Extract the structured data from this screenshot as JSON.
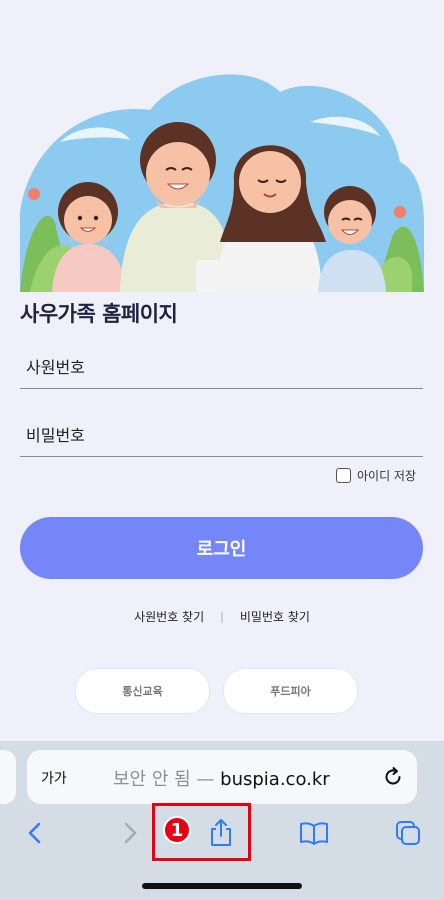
{
  "page": {
    "title": "사우가족 홈페이지",
    "employee_id_placeholder": "사원번호",
    "password_placeholder": "비밀번호",
    "remember_id_label": "아이디 저장",
    "login_label": "로그인",
    "find_employee_id": "사원번호 찾기",
    "find_password": "비밀번호 찾기",
    "quick_links": [
      "통신교육",
      "푸드피아"
    ],
    "accent_color": "#7587f8"
  },
  "browser": {
    "text_size_label": "가가",
    "security_label": "보안 안 됨",
    "separator": "—",
    "domain": "buspia.co.kr",
    "toolbar_icons": [
      "back-icon",
      "forward-icon",
      "share-icon",
      "bookmarks-icon",
      "tabs-icon"
    ]
  },
  "annotation": {
    "step_number": "1",
    "color": "#e60012"
  }
}
